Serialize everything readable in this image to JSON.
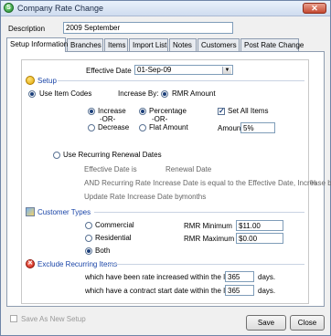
{
  "window": {
    "title": "Company Rate Change",
    "close_glyph": "✕",
    "app_icon": "app-logo-icon",
    "app_icon_glyph": "S"
  },
  "description": {
    "label": "Description",
    "value": "2009 September"
  },
  "tabs": [
    {
      "label": "Setup Information",
      "active": true
    },
    {
      "label": "Branches"
    },
    {
      "label": "Items"
    },
    {
      "label": "Import List"
    },
    {
      "label": "Notes"
    },
    {
      "label": "Customers"
    },
    {
      "label": "Post Rate Change"
    }
  ],
  "effective_date": {
    "label": "Effective Date",
    "value": "01-Sep-09",
    "arrow": "▼"
  },
  "setup": {
    "title": "Setup",
    "use_item_codes": "Use Item Codes",
    "increase_by": "Increase By:",
    "rmr_amount": "RMR Amount",
    "increase": "Increase",
    "or1": "-OR-",
    "decrease": "Decrease",
    "percentage": "Percentage",
    "or2": "-OR-",
    "flat_amount": "Flat Amount",
    "set_all_items": "Set All Items",
    "check_glyph": "✓",
    "amount_label": "Amount",
    "amount_value": "5%",
    "use_recurring": "Use Recurring Renewal Dates",
    "effective_date_is": "Effective Date is",
    "renewal_date": "Renewal Date",
    "and_recurring": "AND Recurring Rate Increase Date is equal  to the Effective Date, Increase by",
    "percent_sign": "%",
    "update_rate": "Update Rate Increase Date by",
    "months": "months"
  },
  "customer_types": {
    "title": "Customer Types",
    "commercial": "Commercial",
    "residential": "Residential",
    "both": "Both",
    "rmr_min_label": "RMR Minimum",
    "rmr_min_value": "$11.00",
    "rmr_max_label": "RMR Maximum",
    "rmr_max_value": "$0.00"
  },
  "exclude": {
    "title": "Exclude Recurring Items",
    "icon_glyph": "✕",
    "row1_text": "which have been rate increased within the last",
    "row1_value": "365",
    "row1_unit": "days.",
    "row2_text": "which have a contract start date within the last",
    "row2_value": "365",
    "row2_unit": "days."
  },
  "footer": {
    "save_as_new": "Save As New Setup",
    "save": "Save",
    "close": "Close"
  }
}
